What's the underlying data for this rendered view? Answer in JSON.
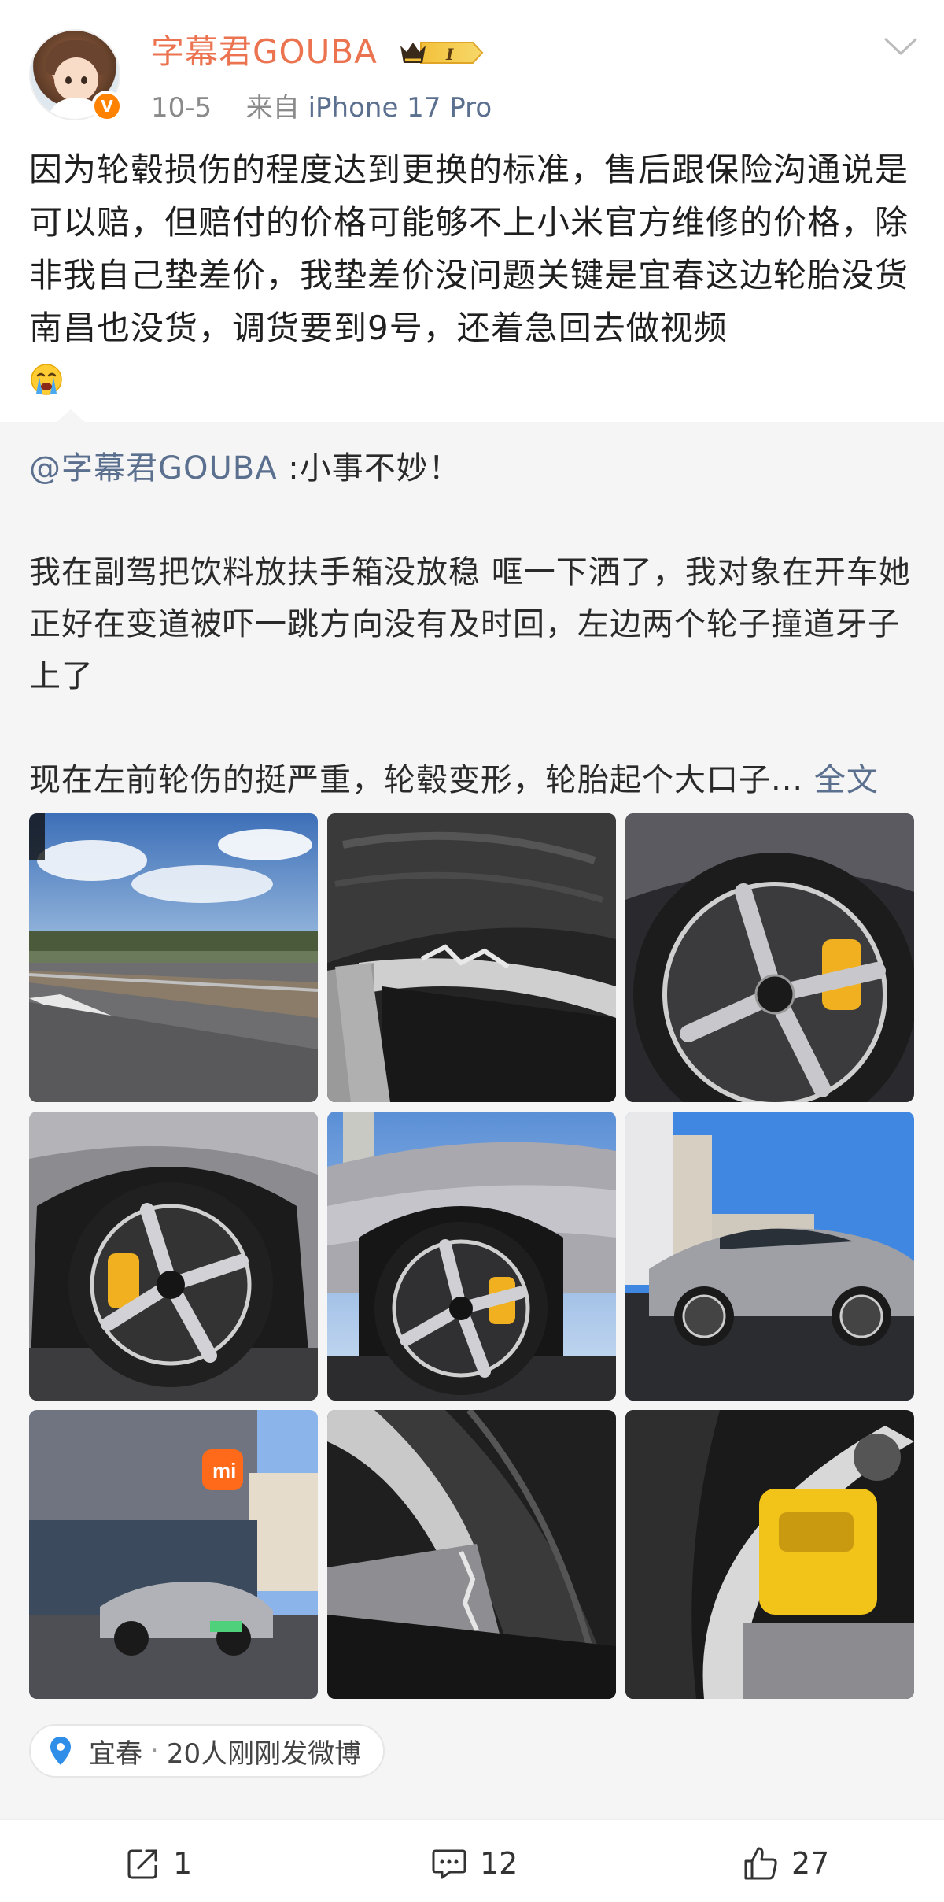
{
  "post": {
    "author": "字幕君GOUBA",
    "vip_level": "I",
    "date": "10-5",
    "source_prefix": "来自",
    "device": "iPhone 17 Pro",
    "text": "因为轮毂损伤的程度达到更换的标准，售后跟保险沟通说是可以赔，但赔付的价格可能够不上小米官方维修的价格，除非我自己垫差价，我垫差价没问题关键是宜春这边轮胎没货南昌也没货，调货要到9号，还着急回去做视频"
  },
  "repost": {
    "mention": "@字幕君GOUBA",
    "line1_rest": " :小事不妙！",
    "para2": "我在副驾把饮料放扶手箱没放稳 哐一下洒了，我对象在开车她正好在变道被吓一跳方向没有及时回，左边两个轮子撞道牙子上了",
    "para3": "现在左前轮伤的挺严重，轮毂变形，轮胎起个大口子...",
    "full_text_link": "全文",
    "photos": [
      "highway-sky-photo",
      "tire-sidewall-damage-photo",
      "wheel-caliper-photo",
      "front-wheel-photo",
      "car-side-wheel-photo",
      "car-profile-photo",
      "xiaomi-store-photo",
      "tire-closeup-photo",
      "yellow-caliper-photo"
    ]
  },
  "location": {
    "city": "宜春",
    "separator": "·",
    "activity": "20人刚刚发微博"
  },
  "actions": {
    "repost_count": "1",
    "comment_count": "12",
    "like_count": "27"
  },
  "colors": {
    "username": "#eb7350",
    "link": "#5b6f8e",
    "verified": "#ff8200",
    "location_pin": "#2f8ee8"
  }
}
